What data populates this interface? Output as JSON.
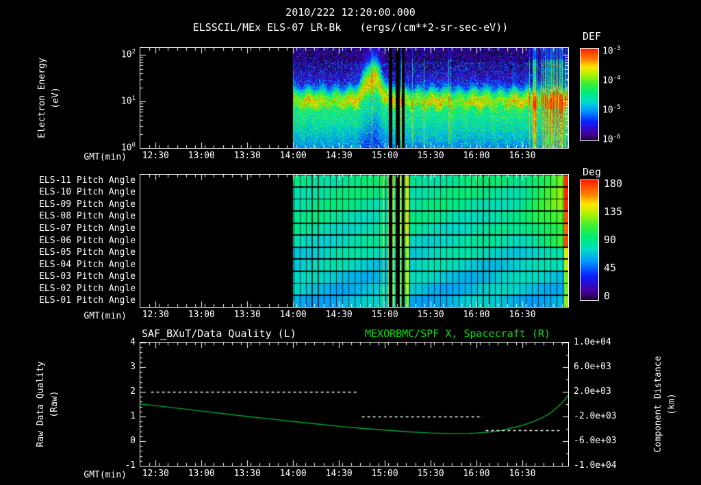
{
  "header": {
    "datetime": "2010/222 12:20:00.000",
    "title": "ELSSCIL/MEx ELS-07 LR-Bk   (ergs/(cm**2-sr-sec-eV))"
  },
  "time_axis": {
    "label": "GMT(min)",
    "span_min": 280,
    "start_label": "12:20",
    "minor_step_min": 6,
    "ticks": [
      {
        "t": 10,
        "label": "12:30"
      },
      {
        "t": 40,
        "label": "13:00"
      },
      {
        "t": 70,
        "label": "13:30"
      },
      {
        "t": 100,
        "label": "14:00"
      },
      {
        "t": 130,
        "label": "14:30"
      },
      {
        "t": 160,
        "label": "15:00"
      },
      {
        "t": 190,
        "label": "15:30"
      },
      {
        "t": 220,
        "label": "16:00"
      },
      {
        "t": 250,
        "label": "16:30"
      }
    ]
  },
  "colors": {
    "background": "#000000",
    "frame": "#ffffff",
    "text": "#ffffff",
    "title_right_green": "#00e600",
    "curve_green": "#00aa33"
  },
  "chart_data": [
    {
      "type": "heatmap",
      "name": "electron-energy-spectrogram",
      "title": "ELSSCIL/MEx ELS-07 LR-Bk",
      "units": "(ergs/(cm**2-sr-sec-eV))",
      "ylabel_lines": [
        "Electron Energy",
        "(eV)"
      ],
      "yscale": "log",
      "ytick_exponents": [
        0,
        1,
        2
      ],
      "log_top": 2.15,
      "colorbar": {
        "title": "DEF",
        "tick_exponents": [
          -3,
          -4,
          -5,
          -6
        ]
      },
      "data_start_min": 100,
      "gaps_min": [
        [
          162.5,
          164.5
        ],
        [
          167,
          169.5
        ],
        [
          171,
          172.5
        ]
      ],
      "band": {
        "base_logE": 1.0,
        "bump_center_min": 152,
        "bump_height": 0.48,
        "bump_width_min": 5
      },
      "streak_zone_min": 256
    },
    {
      "type": "heatmap",
      "name": "pitch-angle-panels",
      "rows": [
        "ELS-11 Pitch Angle",
        "ELS-10 Pitch Angle",
        "ELS-09 Pitch Angle",
        "ELS-08 Pitch Angle",
        "ELS-07 Pitch Angle",
        "ELS-06 Pitch Angle",
        "ELS-05 Pitch Angle",
        "ELS-04 Pitch Angle",
        "ELS-03 Pitch Angle",
        "ELS-02 Pitch Angle",
        "ELS-01 Pitch Angle"
      ],
      "colorbar": {
        "title": "Deg",
        "ticks": [
          180,
          135,
          90,
          45,
          0
        ]
      },
      "data_start_min": 100,
      "gaps_min": [
        [
          162.5,
          164.5
        ],
        [
          167,
          169.5
        ],
        [
          171,
          172.5
        ]
      ],
      "base_deg": 80,
      "row_offset_deg": [
        10,
        8,
        6,
        4,
        2,
        0,
        -3,
        -6,
        -9,
        -11,
        -13
      ],
      "green_zone_min": 248,
      "grid_step_min": 4
    },
    {
      "type": "line",
      "name": "quality-and-spacecraft-x",
      "title_left": "SAF_BXuT/Data Quality (L)",
      "title_right": "MEXORBMC/SPF X, Spacecraft (R)",
      "ylabel_left_lines": [
        "Raw Data Quality",
        "(Raw)"
      ],
      "ylabel_right_lines": [
        "Component Distance",
        "(km)"
      ],
      "left_ticks": [
        4,
        3,
        2,
        1,
        0,
        -1
      ],
      "left_range": [
        -1,
        4
      ],
      "right_tick_labels": [
        "1.0e+04",
        "6.0e+03",
        "2.0e+03",
        "-2.0e+03",
        "-6.0e+03",
        "-1.0e+04"
      ],
      "right_range_km": [
        -10000,
        10000
      ],
      "quality_segments": [
        {
          "t0": 7,
          "t1": 142,
          "value": 2
        },
        {
          "t0": 145,
          "t1": 224,
          "value": 1
        },
        {
          "t0": 226,
          "t1": 275,
          "value": 0.45
        }
      ],
      "spacecraft_x_series": [
        [
          0,
          1.5
        ],
        [
          10,
          1.44
        ],
        [
          25,
          1.33
        ],
        [
          40,
          1.22
        ],
        [
          55,
          1.11
        ],
        [
          70,
          1.0
        ],
        [
          85,
          0.9
        ],
        [
          100,
          0.8
        ],
        [
          115,
          0.7
        ],
        [
          130,
          0.6
        ],
        [
          145,
          0.52
        ],
        [
          160,
          0.45
        ],
        [
          175,
          0.38
        ],
        [
          190,
          0.33
        ],
        [
          205,
          0.31
        ],
        [
          215,
          0.315
        ],
        [
          220,
          0.33
        ],
        [
          228,
          0.37
        ],
        [
          235,
          0.42
        ],
        [
          242,
          0.52
        ],
        [
          250,
          0.64
        ],
        [
          256,
          0.76
        ],
        [
          262,
          0.92
        ],
        [
          268,
          1.12
        ],
        [
          273,
          1.38
        ],
        [
          277,
          1.62
        ],
        [
          280,
          1.86
        ]
      ]
    }
  ]
}
